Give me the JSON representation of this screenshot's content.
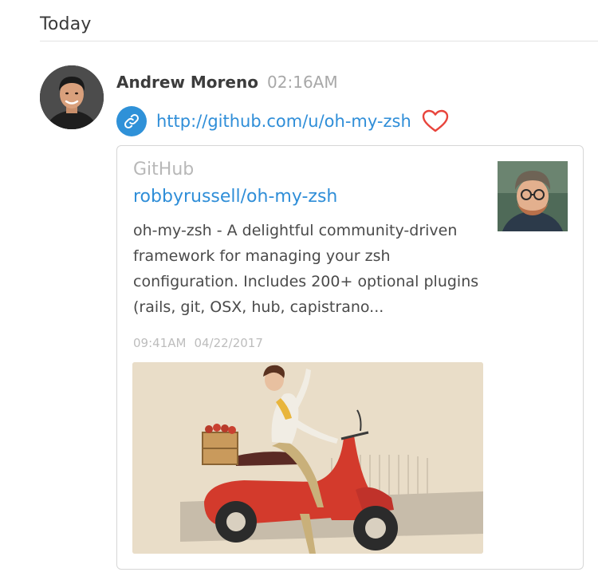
{
  "feed": {
    "day_label": "Today"
  },
  "message": {
    "author": "Andrew Moreno",
    "time": "02:16AM",
    "link_url": "http://github.com/u/oh-my-zsh",
    "icons": {
      "link_badge": "link-icon",
      "like": "heart-icon"
    },
    "colors": {
      "link": "#2f8ed8",
      "like": "#e8443b"
    }
  },
  "preview": {
    "source": "GitHub",
    "title": "robbyrussell/oh-my-zsh",
    "description": "oh-my-zsh - A delightful community-driven framework for managing your zsh configuration. Includes 200+ optional plugins (rails, git, OSX, hub, capistrano...",
    "time": "09:41AM",
    "date": "04/22/2017"
  }
}
